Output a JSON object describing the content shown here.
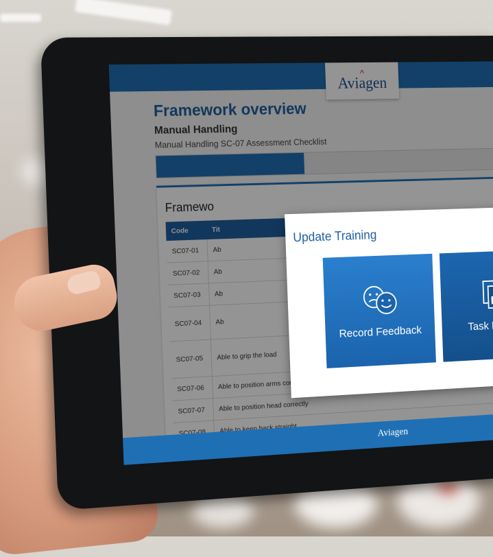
{
  "header": {
    "logo_text": "Aviagen"
  },
  "page": {
    "title": "Framework overview",
    "subtitle": "Manual Handling",
    "description": "Manual Handling SC-07 Assessment Checklist",
    "progress": 0.41
  },
  "framework": {
    "title": "Framewo",
    "columns": [
      "Code",
      "Tit"
    ],
    "rows": [
      {
        "code": "SC07-01",
        "title": "Ab"
      },
      {
        "code": "SC07-02",
        "title": "Ab"
      },
      {
        "code": "SC07-03",
        "title": "Ab"
      },
      {
        "code": "SC07-04",
        "title": "Ab"
      },
      {
        "code": "SC07-05",
        "title": "Able to grip the load"
      },
      {
        "code": "SC07-06",
        "title": "Able to position arms correctly"
      },
      {
        "code": "SC07-07",
        "title": "Able to position head correctly"
      },
      {
        "code": "SC07-08",
        "title": "Able to keep back straight"
      }
    ]
  },
  "modal": {
    "title": "Update Training",
    "tiles": [
      {
        "label": "Record Feedback",
        "icon": "smiley-faces-icon"
      },
      {
        "label": "Task Eviden",
        "icon": "documents-icon"
      }
    ]
  },
  "footer": {
    "logo_text": "Aviagen"
  },
  "colors": {
    "brand_blue": "#1f6fb4",
    "title_blue": "#1f5f9f",
    "logo_red": "#d2232a"
  }
}
